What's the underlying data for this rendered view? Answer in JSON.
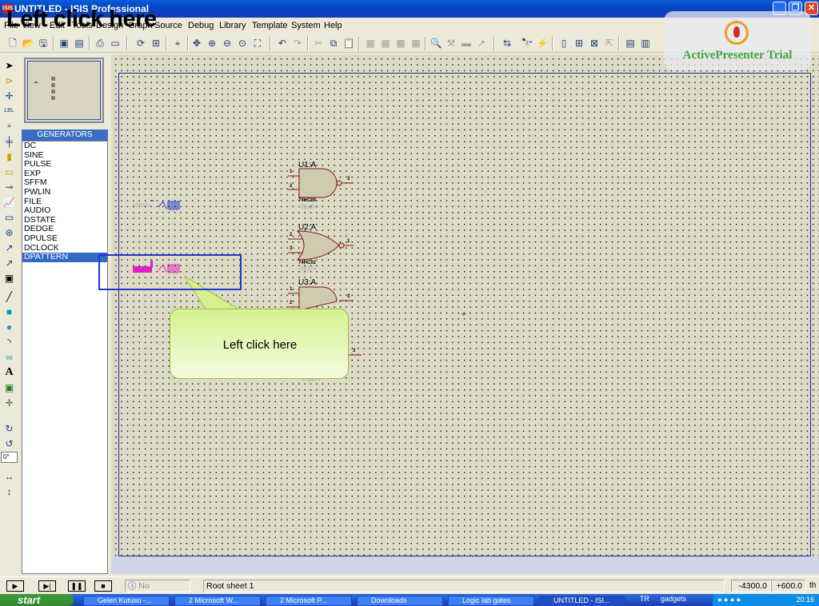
{
  "app": {
    "title": "UNTITLED - ISIS Professional",
    "icon_label": "ISIS"
  },
  "overlay_heading": "Left click here",
  "menu": [
    "File",
    "View",
    "Edit",
    "Tools",
    "Design",
    "Graph",
    "Source",
    "Debug",
    "Library",
    "Template",
    "System",
    "Help"
  ],
  "toolbar": {
    "icons": [
      "new-icon",
      "open-icon",
      "save-icon",
      "import-icon",
      "export-icon",
      "print-icon",
      "area-icon",
      "refresh-icon",
      "grid-icon",
      "origin-icon",
      "pan-icon",
      "zoom-in-icon",
      "zoom-out-icon",
      "zoom-all-icon",
      "zoom-area-icon",
      "undo-icon",
      "redo-icon",
      "cut-icon",
      "copy-icon",
      "paste-icon",
      "block-copy-icon",
      "block-move-icon",
      "block-rotate-icon",
      "block-delete-icon",
      "pick-icon",
      "make-device-icon",
      "packaging-icon",
      "decompose-icon",
      "wire-autorouter-icon",
      "search-icon",
      "property-tool-icon",
      "new-sheet-icon",
      "delete-sheet-icon",
      "exit-to-parent-icon",
      "bom-icon",
      "erc-icon",
      "netlist-icon"
    ]
  },
  "left_toolbar": {
    "icons": [
      "selection-icon",
      "component-icon",
      "junction-icon",
      "wire-label-icon",
      "text-script-icon",
      "bus-icon",
      "subcircuit-icon",
      "terminal-icon",
      "pin-icon",
      "graph-icon",
      "tape-recorder-icon",
      "generator-icon",
      "voltage-probe-icon",
      "current-probe-icon",
      "virtual-instrument-icon",
      "line-icon",
      "box-icon",
      "circle-icon",
      "arc-icon",
      "path-icon",
      "text-icon",
      "symbol-icon",
      "marker-icon",
      "rotate-cw-icon",
      "rotate-ccw-icon",
      "mirror-x-icon",
      "mirror-y-icon"
    ],
    "rotation_value": "0°"
  },
  "generators": {
    "header": "GENERATORS",
    "items": [
      "DC",
      "SINE",
      "PULSE",
      "EXP",
      "SFFM",
      "PWLIN",
      "FILE",
      "AUDIO",
      "DSTATE",
      "DEDGE",
      "DPULSE",
      "DCLOCK",
      "DPATTERN"
    ],
    "selected": "DPATTERN"
  },
  "schematic": {
    "gates": [
      {
        "ref": "U1:A",
        "part": "74HC00",
        "text": "<TEXT>",
        "pins": [
          "1",
          "2",
          "3"
        ]
      },
      {
        "ref": "U2:A",
        "part": "74HC02",
        "text": "<TEXT>",
        "pins": [
          "2",
          "3",
          "1"
        ]
      },
      {
        "ref": "U3:A",
        "part": "",
        "text": "<TEXT>",
        "pins": [
          "1",
          "2",
          "3"
        ]
      }
    ],
    "generator_text": "<TEXT>",
    "lower_text": "<TEXT>",
    "pin_3_label": "3"
  },
  "callout": {
    "text": "Left click here"
  },
  "watermark": {
    "text": "ActivePresenter Trial"
  },
  "status": {
    "messages": "No Messages",
    "sheet": "Root sheet 1",
    "x": "-4300.0",
    "y": "+600.0",
    "unit": "th"
  },
  "taskbar": {
    "start": "start",
    "tasks": [
      "Gelen Kutusu -...",
      "2 Microsoft W...",
      "2 Microsoft P...",
      "Downloads",
      "Logic lab gates",
      "UNTITLED - ISI..."
    ],
    "tray_lang": "TR",
    "tray_text": "gadgets",
    "clock": "20:16"
  },
  "colors": {
    "titlebar": "#0444c4",
    "canvas": "#dddac5",
    "selection": "#316ac5",
    "gate_fill": "#cfcbb0",
    "gate_stroke": "#8b1a1a",
    "generator_pink": "#e020c0",
    "callout": "#d6f290",
    "trial_text": "#3aa83a"
  }
}
